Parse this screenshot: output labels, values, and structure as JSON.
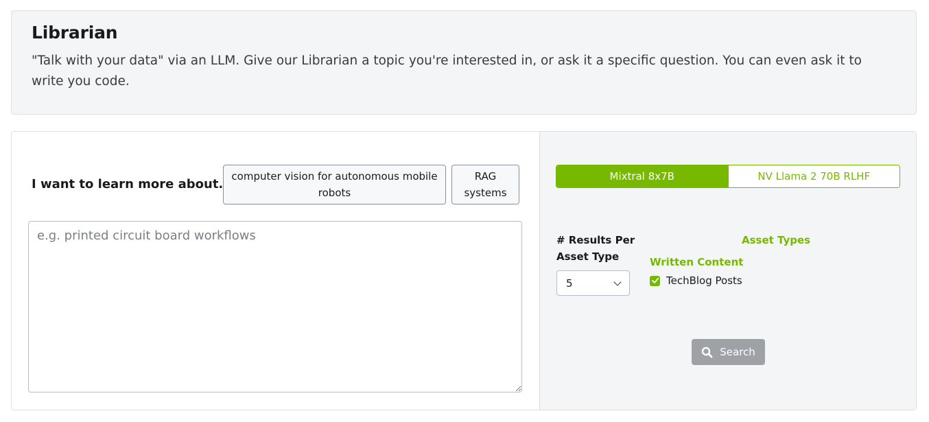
{
  "header": {
    "title": "Librarian",
    "description": "\"Talk with your data\" via an LLM. Give our Librarian a topic you're interested in, or ask it a specific question. You can even ask it to write you code."
  },
  "query": {
    "label": "I want to learn more about...",
    "suggestions": [
      "computer vision for autonomous mobile robots",
      "RAG systems"
    ],
    "input_value": "",
    "input_placeholder": "e.g. printed circuit board workflows"
  },
  "settings": {
    "models": [
      {
        "label": "Mixtral 8x7B",
        "selected": true
      },
      {
        "label": "NV Llama 2 70B RLHF",
        "selected": false
      }
    ],
    "results_label": "# Results Per Asset Type",
    "results_value": "5",
    "asset_types_heading": "Asset Types",
    "written_content_heading": "Written Content",
    "asset_options": [
      {
        "label": "TechBlog Posts",
        "checked": true
      }
    ],
    "search_label": "Search"
  },
  "colors": {
    "accent": "#76b900",
    "panel_bg": "#f4f5f7",
    "button_disabled": "#9ea2a6"
  },
  "icons": {
    "search": "search-icon",
    "check": "check-icon",
    "dropdown": "chevron-down-icon"
  }
}
